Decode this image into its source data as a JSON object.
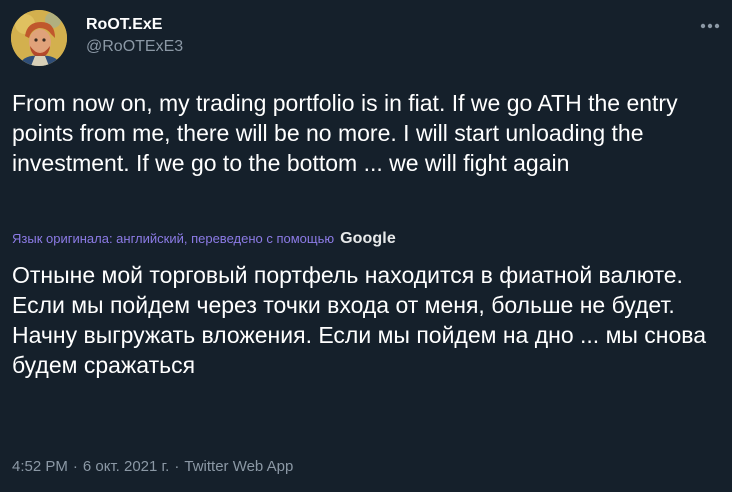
{
  "author": {
    "display_name": "RoOT.ExE",
    "handle": "@RoOTExE3"
  },
  "tweet": {
    "text": "From now on, my trading portfolio is in fiat. If we go ATH the entry points from me, there will be no more. I will start unloading the investment. If we go to the bottom ... we will fight again",
    "translation_note": "Язык оригинала: английский, переведено с помощью",
    "translation_provider": "Google",
    "translated_text": "Отныне мой торговый портфель находится в фиатной валюте. Если мы пойдем через точки входа от меня, больше не будет. Начну выгружать вложения. Если мы пойдем на дно ... мы снова будем сражаться"
  },
  "meta": {
    "time": "4:52 PM",
    "separator": "·",
    "date": "6 окт. 2021 г.",
    "source": "Twitter Web App"
  },
  "icons": {
    "more": "more-horizontal-icon",
    "avatar": "avatar-image"
  },
  "colors": {
    "background": "#15202b",
    "text": "#ffffff",
    "muted": "#8b98a5",
    "translation_link": "#8c7be6"
  }
}
